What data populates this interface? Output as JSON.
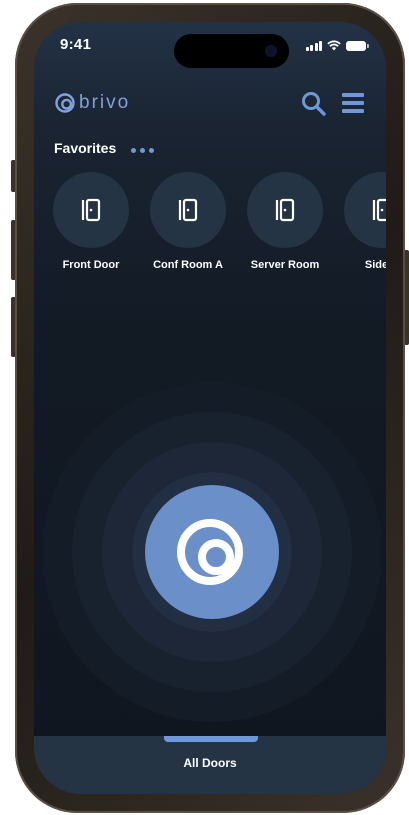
{
  "status_bar": {
    "time": "9:41"
  },
  "header": {
    "logo_text": "brivo",
    "search_icon": "search-icon",
    "menu_icon": "hamburger-menu-icon"
  },
  "favorites": {
    "title": "Favorites",
    "more_icon": "more-dots-icon",
    "items": [
      {
        "label": "Front Door",
        "icon": "door-icon"
      },
      {
        "label": "Conf Room A",
        "icon": "door-icon"
      },
      {
        "label": "Server Room",
        "icon": "door-icon"
      },
      {
        "label": "Side D",
        "icon": "door-icon"
      }
    ]
  },
  "unlock_button": {
    "icon": "brivo-logo-icon"
  },
  "bottom_nav": {
    "label": "All Doors"
  },
  "colors": {
    "accent": "#6e98d8",
    "unlock_fill": "#6a8fc9",
    "background": "#121a24",
    "tile": "#253445"
  }
}
